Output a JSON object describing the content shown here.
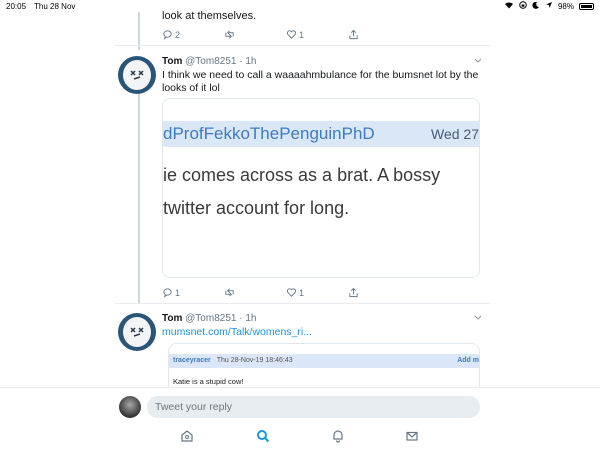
{
  "status": {
    "time": "20:05",
    "date": "Thu 28 Nov",
    "battery": "98%"
  },
  "prev_tweet": {
    "text": "look at themselves.",
    "replies": "2",
    "likes": "1"
  },
  "tweet1": {
    "name": "Tom",
    "handle_time": "@Tom8251 · 1h",
    "text": "I think we need to call a waaaahmbulance for the bumsnet lot by the looks of it lol",
    "card": {
      "user": "dProfFekkoThePenguinPhD",
      "date": "Wed 27",
      "line1": "ie comes across as a brat. A bossy",
      "line2": "twitter account for long."
    },
    "replies": "1",
    "likes": "1"
  },
  "tweet2": {
    "name": "Tom",
    "handle_time": "@Tom8251 · 1h",
    "link": "mumsnet.com/Talk/womens_ri...",
    "card": {
      "user": "traceyracer",
      "date": "Thu 28-Nov-19 18:46:43",
      "add": "Add m",
      "text": "Katie is a stupid cow!"
    }
  },
  "reply_bar": {
    "placeholder": "Tweet your reply"
  },
  "icons": {
    "reply": "reply-icon",
    "retweet": "retweet-icon",
    "like": "heart-icon",
    "share": "share-icon",
    "home": "home-icon",
    "search": "search-icon",
    "notifications": "bell-icon",
    "messages": "mail-icon"
  },
  "colors": {
    "accent": "#1b95e0",
    "thread_line": "#ccd6dd",
    "muted": "#657786"
  }
}
